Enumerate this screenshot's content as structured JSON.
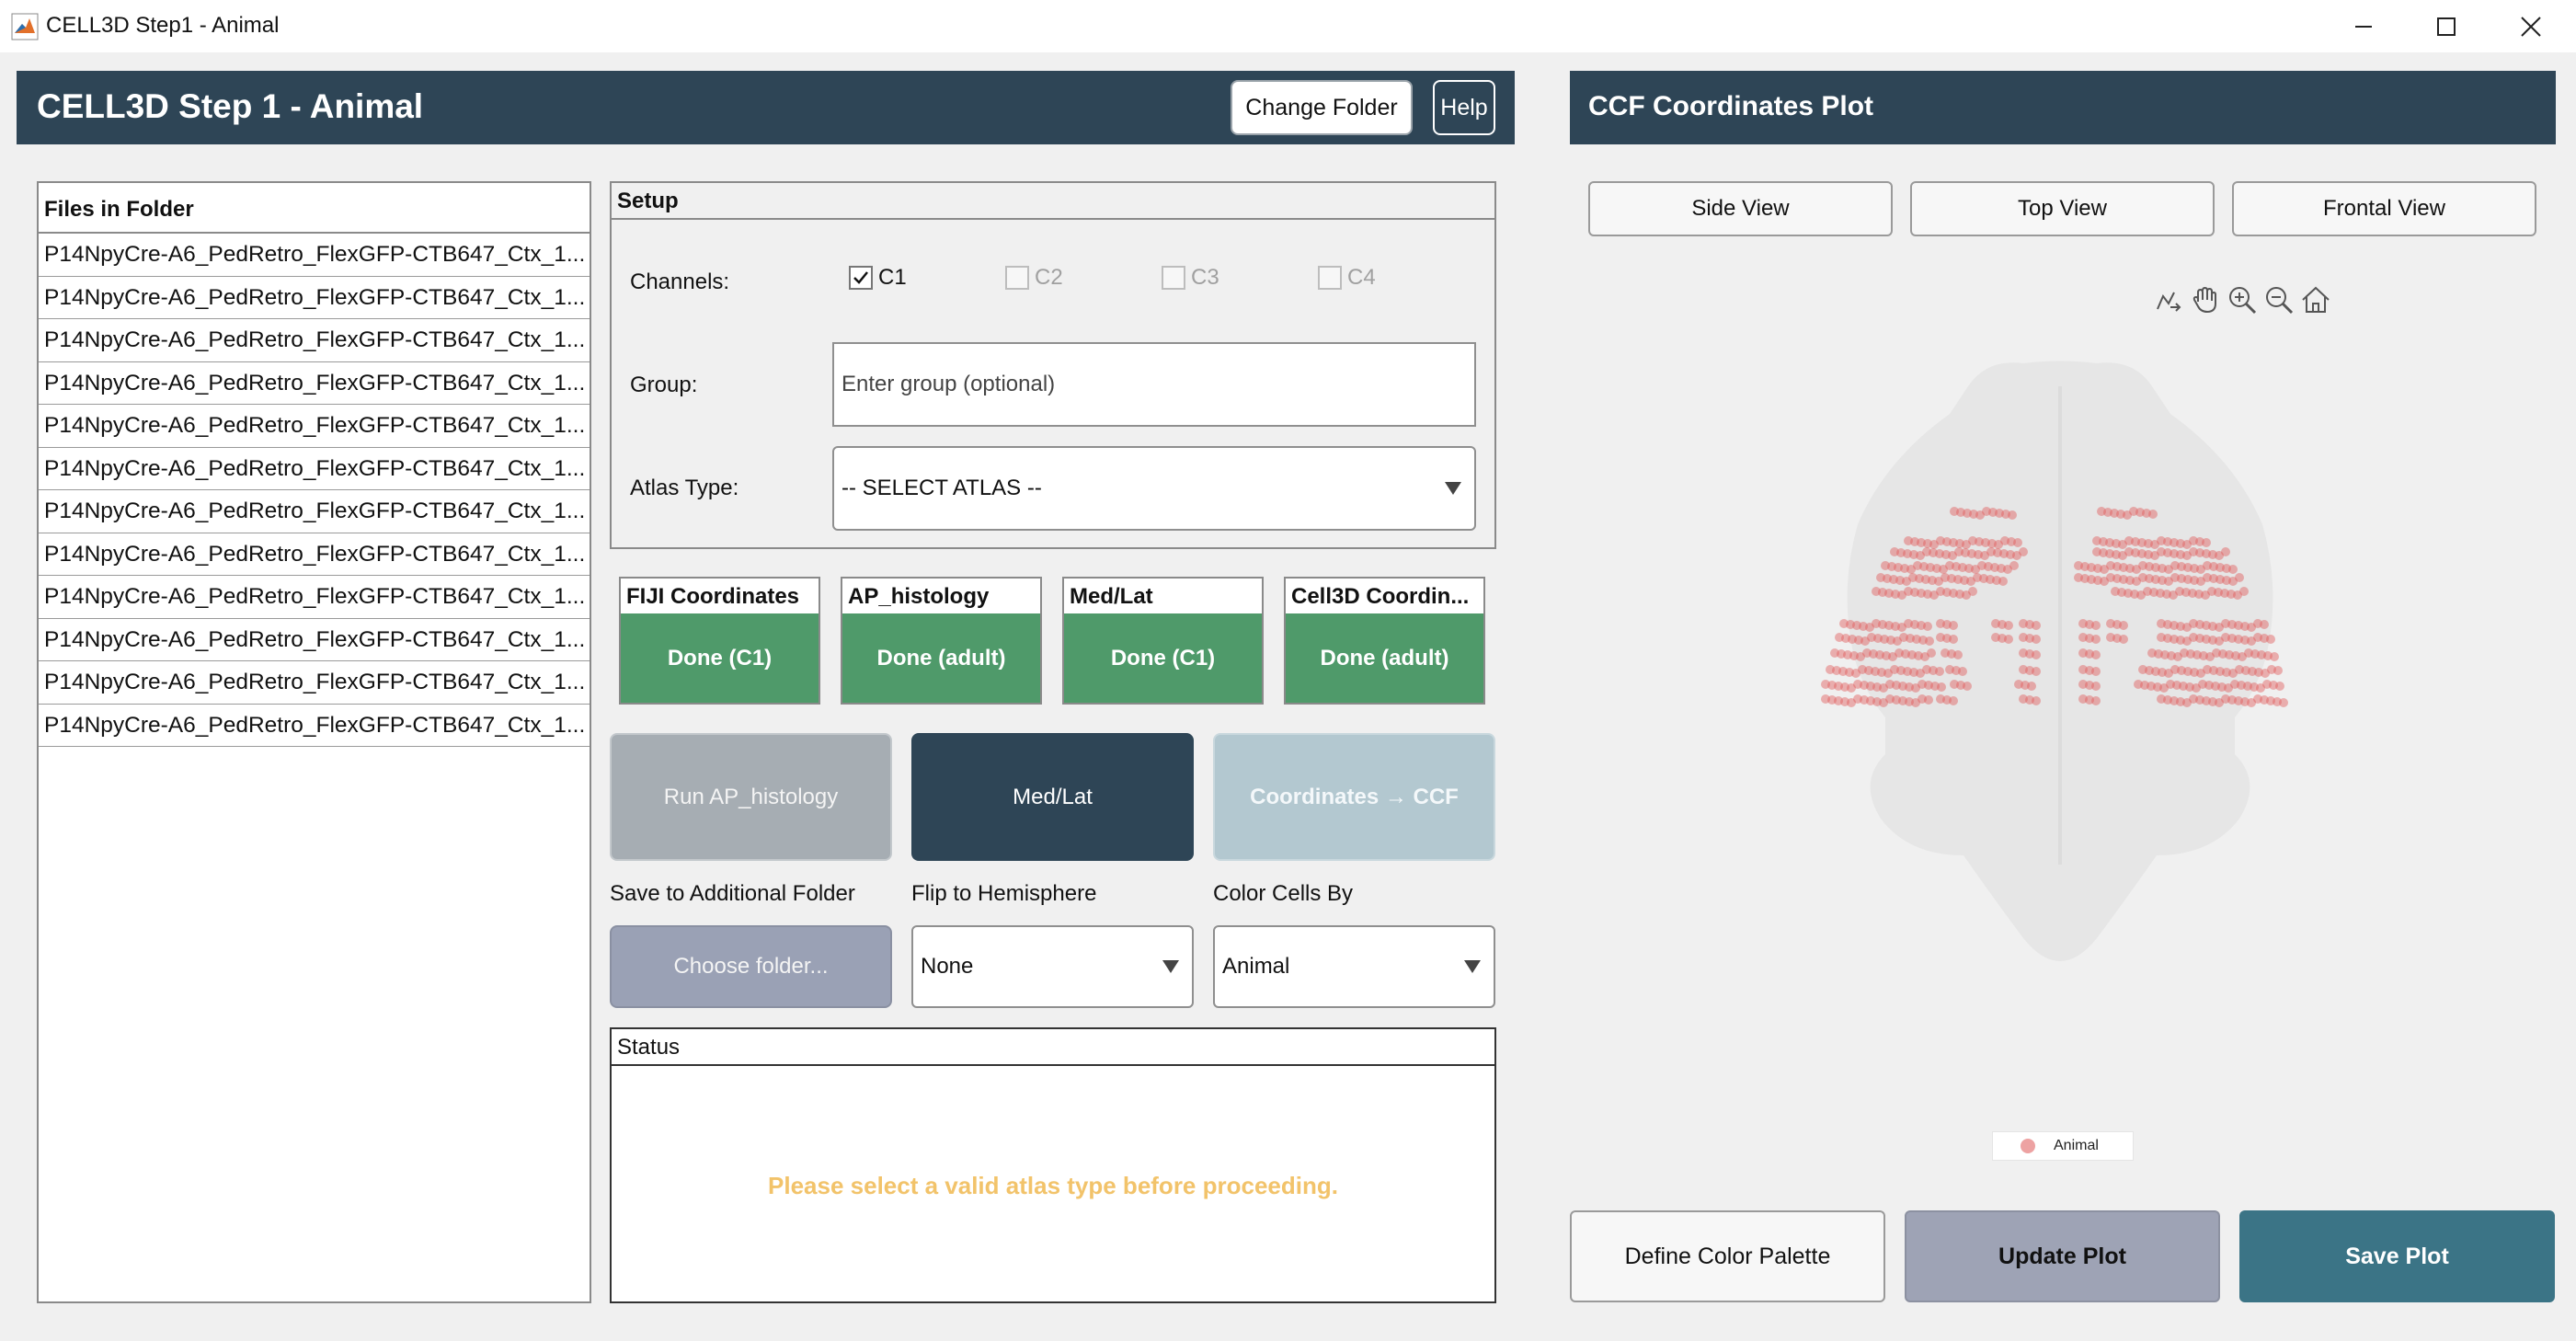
{
  "window": {
    "title": "CELL3D Step1 - Animal",
    "controls": [
      "minimize-icon",
      "maximize-icon",
      "close-icon"
    ]
  },
  "main": {
    "title": "CELL3D Step 1 - Animal",
    "change_folder_label": "Change Folder",
    "help_label": "Help"
  },
  "files": {
    "header": "Files in Folder",
    "items": [
      "P14NpyCre-A6_PedRetro_FlexGFP-CTB647_Ctx_1...",
      "P14NpyCre-A6_PedRetro_FlexGFP-CTB647_Ctx_1...",
      "P14NpyCre-A6_PedRetro_FlexGFP-CTB647_Ctx_1...",
      "P14NpyCre-A6_PedRetro_FlexGFP-CTB647_Ctx_1...",
      "P14NpyCre-A6_PedRetro_FlexGFP-CTB647_Ctx_1...",
      "P14NpyCre-A6_PedRetro_FlexGFP-CTB647_Ctx_1...",
      "P14NpyCre-A6_PedRetro_FlexGFP-CTB647_Ctx_1...",
      "P14NpyCre-A6_PedRetro_FlexGFP-CTB647_Ctx_1...",
      "P14NpyCre-A6_PedRetro_FlexGFP-CTB647_Ctx_1...",
      "P14NpyCre-A6_PedRetro_FlexGFP-CTB647_Ctx_1...",
      "P14NpyCre-A6_PedRetro_FlexGFP-CTB647_Ctx_1...",
      "P14NpyCre-A6_PedRetro_FlexGFP-CTB647_Ctx_1..."
    ]
  },
  "setup": {
    "header": "Setup",
    "channels_label": "Channels:",
    "channels": [
      {
        "label": "C1",
        "checked": true,
        "enabled": true
      },
      {
        "label": "C2",
        "checked": false,
        "enabled": false
      },
      {
        "label": "C3",
        "checked": false,
        "enabled": false
      },
      {
        "label": "C4",
        "checked": false,
        "enabled": false
      }
    ],
    "group_label": "Group:",
    "group_placeholder": "Enter group (optional)",
    "atlas_label": "Atlas Type:",
    "atlas_value": "-- SELECT ATLAS --"
  },
  "cards": [
    {
      "title": "FIJI Coordinates",
      "value": "Done (C1)"
    },
    {
      "title": "AP_histology",
      "value": "Done (adult)"
    },
    {
      "title": "Med/Lat",
      "value": "Done (C1)"
    },
    {
      "title": "Cell3D Coordin...",
      "value": "Done (adult)"
    }
  ],
  "actions": {
    "run_ap": "Run AP_histology",
    "medlat": "Med/Lat",
    "coords_ccf": "Coordinates → CCF"
  },
  "options": {
    "save_label": "Save to Additional Folder",
    "choose_folder": "Choose folder...",
    "flip_label": "Flip to Hemisphere",
    "flip_value": "None",
    "color_label": "Color Cells By",
    "color_value": "Animal"
  },
  "status": {
    "header": "Status",
    "message": "Please select a valid atlas type before proceeding."
  },
  "plot_panel": {
    "title": "CCF Coordinates Plot",
    "side_view": "Side View",
    "top_view": "Top View",
    "frontal_view": "Frontal View",
    "tools": [
      "data-tip-icon",
      "pan-icon",
      "zoom-in-icon",
      "zoom-out-icon",
      "home-icon"
    ],
    "legend_label": "Animal",
    "define_palette": "Define Color Palette",
    "update_plot": "Update Plot",
    "save_plot": "Save Plot"
  },
  "colors": {
    "header_bg": "#2e4556",
    "card_green": "#4f9a6a",
    "button_gray": "#a6adb3",
    "button_light_blue": "#b3c8d0",
    "choose_folder_bg": "#9aa1b5",
    "update_plot_bg": "#9ea3b5",
    "save_plot_bg": "#3b7486",
    "status_message": "#f2c36a",
    "cell_marker": "#e05a5a",
    "brain_outline": "#e6e6e6"
  }
}
